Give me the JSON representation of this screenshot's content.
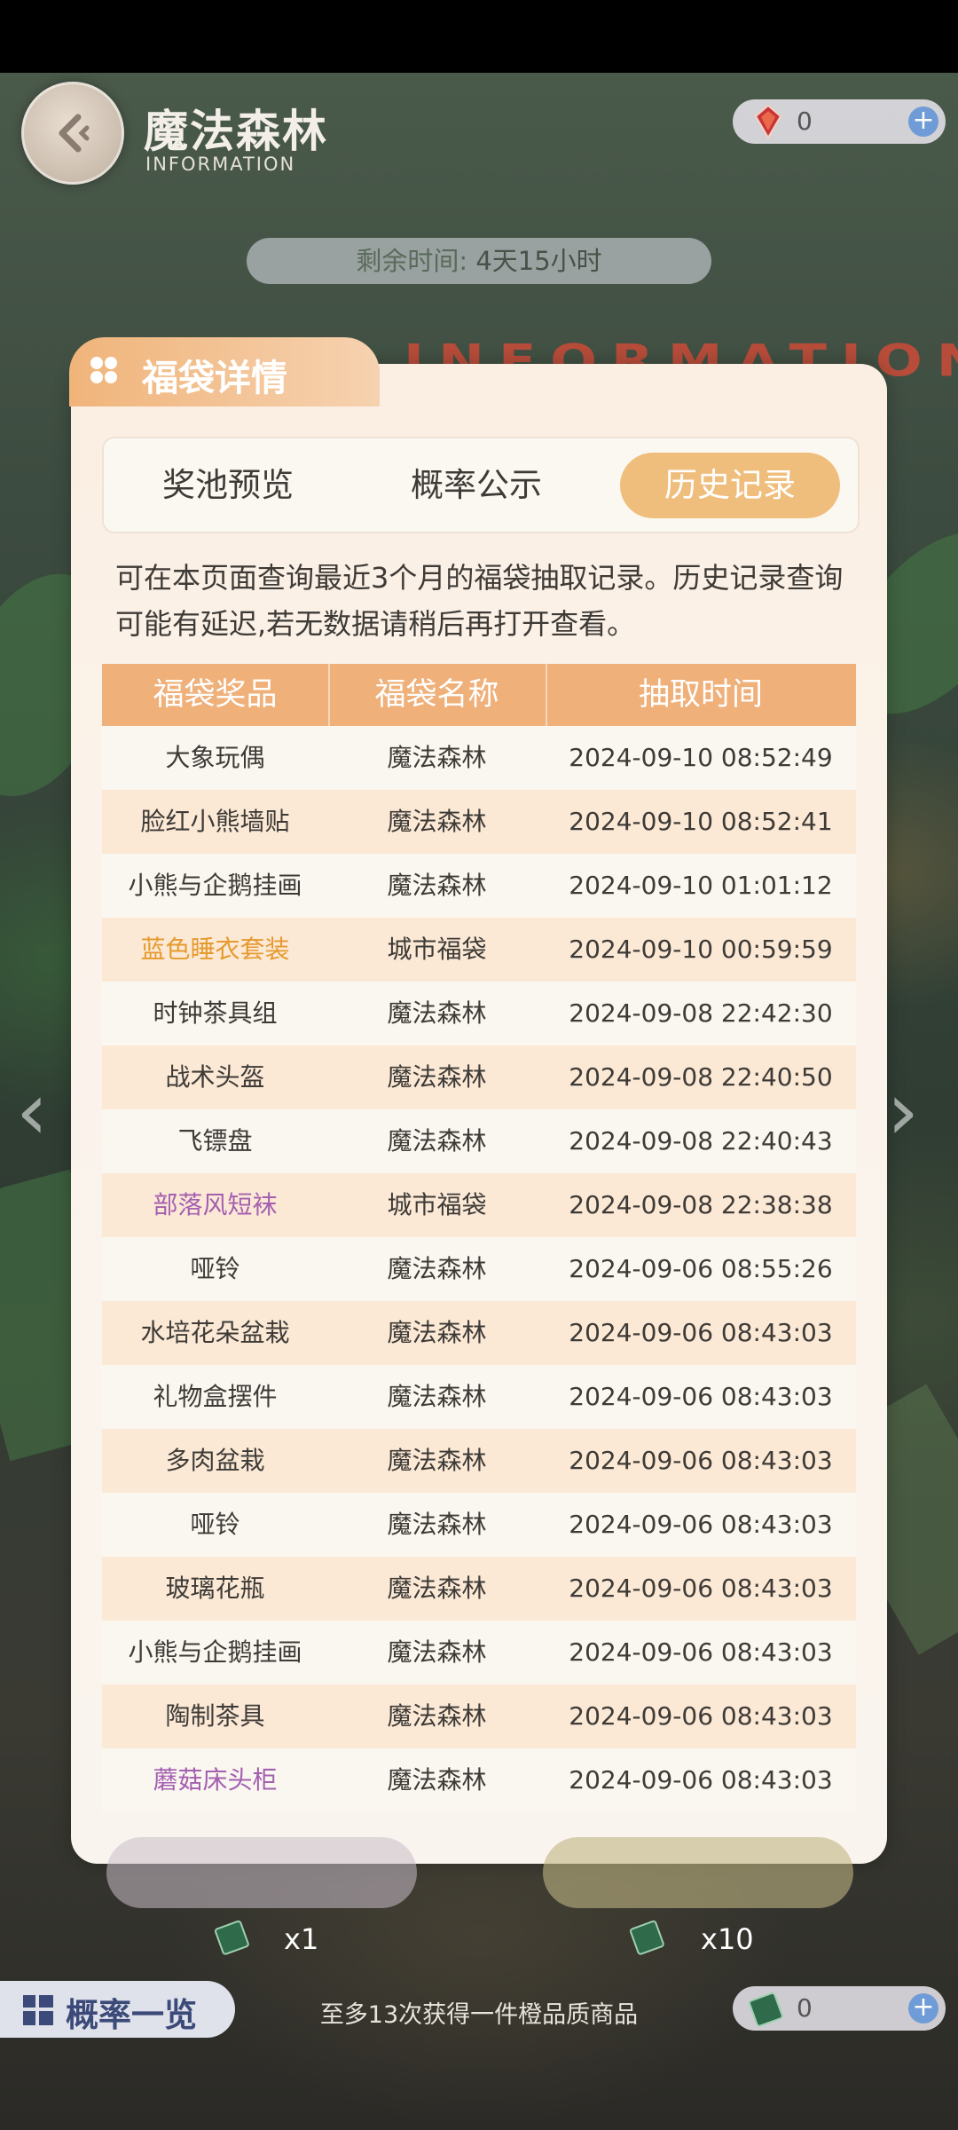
{
  "header": {
    "title": "魔法森林",
    "subtitle": "INFORMATION",
    "currency_value": "0",
    "timer_label": "剩余时间:",
    "timer_value": "4天15小时",
    "background_text": "INFORMATION"
  },
  "panel": {
    "tab_title": "福袋详情",
    "tabs": [
      {
        "label": "奖池预览",
        "active": false
      },
      {
        "label": "概率公示",
        "active": false
      },
      {
        "label": "历史记录",
        "active": true
      }
    ],
    "description": "可在本页面查询最近3个月的福袋抽取记录。历史记录查询可能有延迟,若无数据请稍后再打开查看。",
    "columns": [
      "福袋奖品",
      "福袋名称",
      "抽取时间"
    ],
    "rows": [
      {
        "prize": "大象玩偶",
        "bag": "魔法森林",
        "time": "2024-09-10 08:52:49",
        "color": "#3e3a36"
      },
      {
        "prize": "脸红小熊墙贴",
        "bag": "魔法森林",
        "time": "2024-09-10 08:52:41",
        "color": "#3e3a36"
      },
      {
        "prize": "小熊与企鹅挂画",
        "bag": "魔法森林",
        "time": "2024-09-10 01:01:12",
        "color": "#3e3a36"
      },
      {
        "prize": "蓝色睡衣套装",
        "bag": "城市福袋",
        "time": "2024-09-10 00:59:59",
        "color": "#e69a2e"
      },
      {
        "prize": "时钟茶具组",
        "bag": "魔法森林",
        "time": "2024-09-08 22:42:30",
        "color": "#3e3a36"
      },
      {
        "prize": "战术头盔",
        "bag": "魔法森林",
        "time": "2024-09-08 22:40:50",
        "color": "#3e3a36"
      },
      {
        "prize": "飞镖盘",
        "bag": "魔法森林",
        "time": "2024-09-08 22:40:43",
        "color": "#3e3a36"
      },
      {
        "prize": "部落风短袜",
        "bag": "城市福袋",
        "time": "2024-09-08 22:38:38",
        "color": "#a45fb0"
      },
      {
        "prize": "哑铃",
        "bag": "魔法森林",
        "time": "2024-09-06 08:55:26",
        "color": "#3e3a36"
      },
      {
        "prize": "水培花朵盆栽",
        "bag": "魔法森林",
        "time": "2024-09-06 08:43:03",
        "color": "#3e3a36"
      },
      {
        "prize": "礼物盒摆件",
        "bag": "魔法森林",
        "time": "2024-09-06 08:43:03",
        "color": "#3e3a36"
      },
      {
        "prize": "多肉盆栽",
        "bag": "魔法森林",
        "time": "2024-09-06 08:43:03",
        "color": "#3e3a36"
      },
      {
        "prize": "哑铃",
        "bag": "魔法森林",
        "time": "2024-09-06 08:43:03",
        "color": "#3e3a36"
      },
      {
        "prize": "玻璃花瓶",
        "bag": "魔法森林",
        "time": "2024-09-06 08:43:03",
        "color": "#3e3a36"
      },
      {
        "prize": "小熊与企鹅挂画",
        "bag": "魔法森林",
        "time": "2024-09-06 08:43:03",
        "color": "#3e3a36"
      },
      {
        "prize": "陶制茶具",
        "bag": "魔法森林",
        "time": "2024-09-06 08:43:03",
        "color": "#3e3a36"
      },
      {
        "prize": "蘑菇床头柜",
        "bag": "魔法森林",
        "time": "2024-09-06 08:43:03",
        "color": "#a45fb0"
      }
    ]
  },
  "bottom": {
    "open_once_count": "x1",
    "open_ten_count": "x10",
    "rate_button": "概率一览",
    "hint": "至多13次获得一件橙品质商品",
    "ticket_value": "0"
  },
  "colors": {
    "accent": "#efb07a",
    "tab_active": "#f0be7c",
    "orange_quality": "#e69a2e",
    "purple_quality": "#a45fb0"
  }
}
